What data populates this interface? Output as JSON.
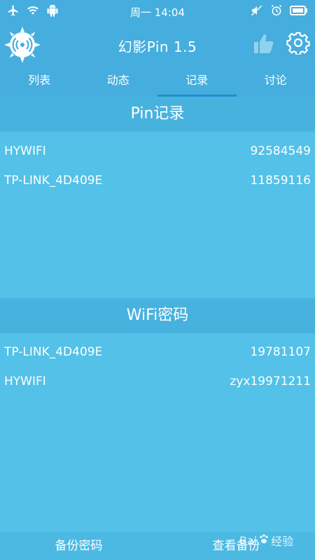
{
  "status_bar": {
    "time": "周一 14:04",
    "icons_left": [
      "airplane-icon",
      "wifi-icon",
      "android-icon"
    ],
    "icons_right": [
      "mute-icon",
      "alarm-icon",
      "battery-icon"
    ]
  },
  "header": {
    "title": "幻影Pin 1.5",
    "logo": "radar-logo-icon",
    "actions": [
      "thumbs-up-icon",
      "gear-icon"
    ]
  },
  "tabs": [
    {
      "label": "列表",
      "active": false
    },
    {
      "label": "动态",
      "active": false
    },
    {
      "label": "记录",
      "active": true
    },
    {
      "label": "讨论",
      "active": false
    }
  ],
  "pin_section": {
    "title": "Pin记录",
    "rows": [
      {
        "name": "HYWIFI",
        "value": "92584549"
      },
      {
        "name": "TP-LINK_4D409E",
        "value": "11859116"
      }
    ]
  },
  "wifi_section": {
    "title": "WiFi密码",
    "rows": [
      {
        "name": "TP-LINK_4D409E",
        "value": "19781107"
      },
      {
        "name": "HYWIFI",
        "value": "zyx19971211"
      }
    ]
  },
  "bottom_bar": {
    "backup_label": "备份密码",
    "view_backup_label": "查看备份"
  },
  "watermark": {
    "text": "Bai",
    "text2": "经验"
  },
  "colors": {
    "primary": "#45aede",
    "body": "#53c1e8",
    "accent": "#1f8fcf"
  }
}
